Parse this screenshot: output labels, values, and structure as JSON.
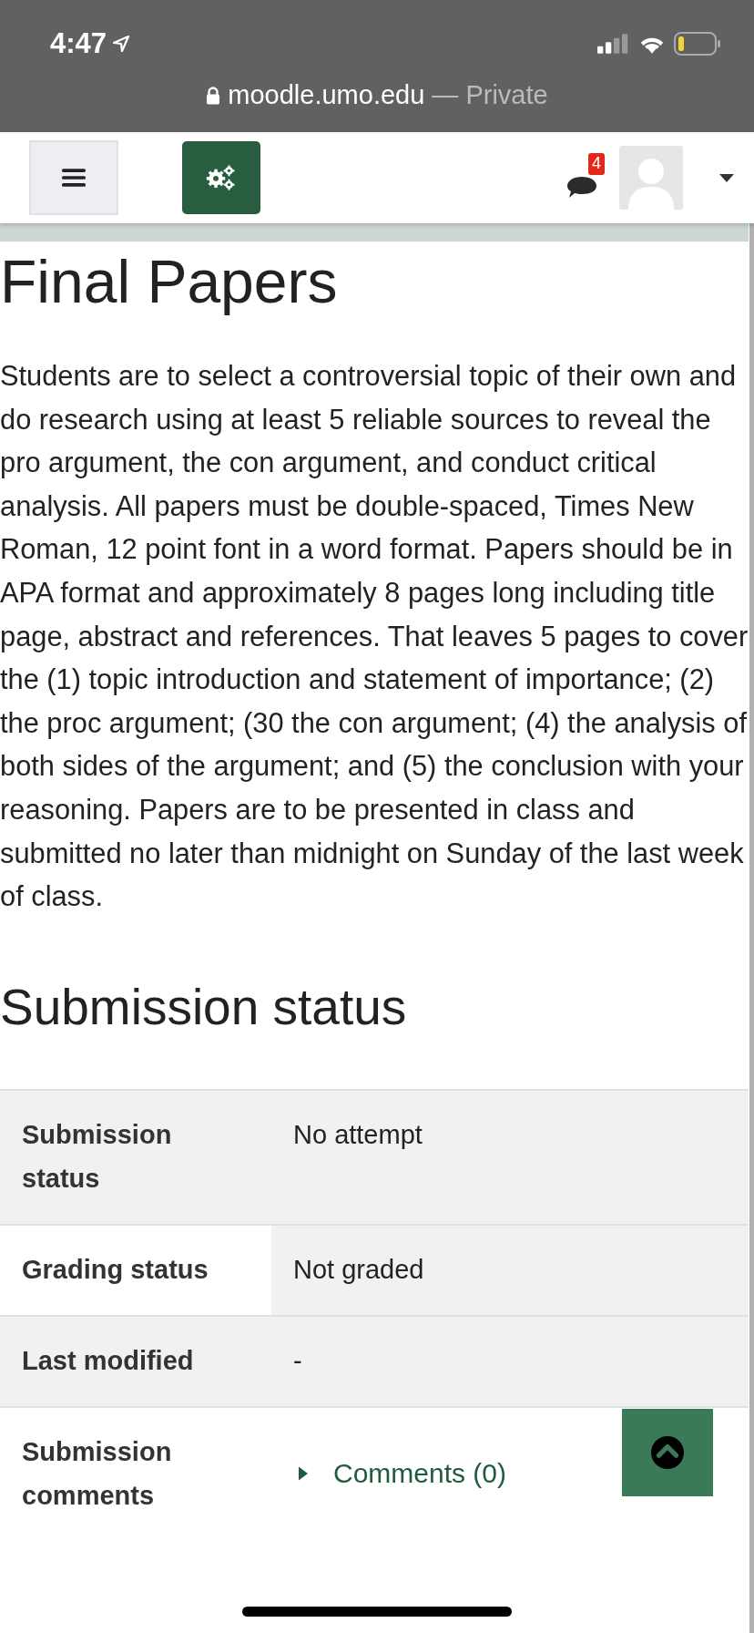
{
  "status_bar": {
    "time": "4:47"
  },
  "address_bar": {
    "domain": "moodle.umo.edu",
    "mode": "— Private"
  },
  "header": {
    "notification_count": "4"
  },
  "title": "Final Papers",
  "intro": "Students are to select a controversial topic of their own and do research using at least 5 reliable sources to reveal the pro argument, the con argument, and conduct critical analysis.  All papers must be double-spaced, Times New Roman, 12 point font in a word format.  Papers should be in APA format and approximately 8 pages long including title page, abstract and references.  That leaves 5 pages to cover the (1) topic introduction and statement of importance; (2) the proc argument; (30 the con argument; (4) the analysis of both sides of the argument; and (5) the conclusion with your reasoning.  Papers are to be presented in class and submitted no later than midnight on Sunday of the last week of class.",
  "section_heading": "Submission status",
  "table": {
    "rows": [
      {
        "kind": "text",
        "label": "Submission status",
        "value": "No attempt",
        "label_shaded": true,
        "value_shaded": true
      },
      {
        "kind": "text",
        "label": "Grading status",
        "value": "Not graded",
        "label_shaded": false,
        "value_shaded": true
      },
      {
        "kind": "text",
        "label": "Last modified",
        "value": "-",
        "label_shaded": true,
        "value_shaded": true
      },
      {
        "kind": "comments",
        "label": "Submission comments",
        "value": "Comments (0)",
        "label_shaded": false,
        "value_shaded": false
      }
    ]
  }
}
